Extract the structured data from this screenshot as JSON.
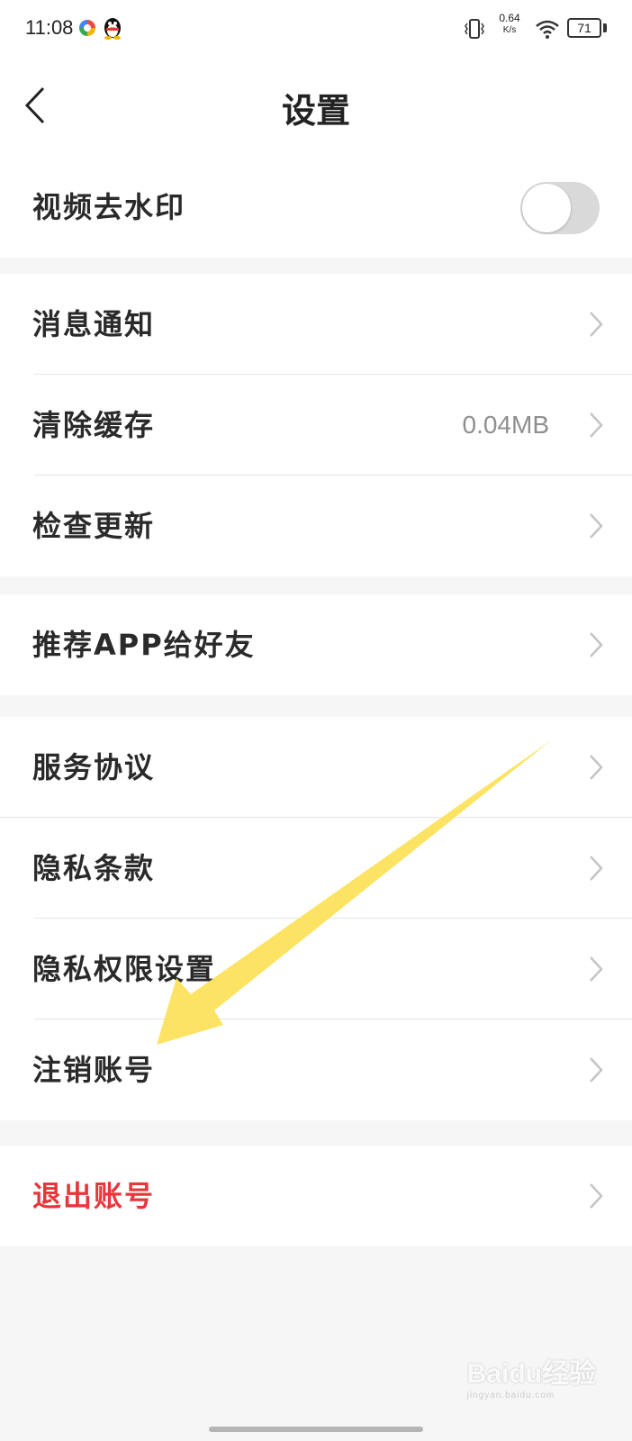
{
  "status_bar": {
    "time": "11:08",
    "net_speed_value": "0.64",
    "net_speed_unit": "K/s",
    "battery": "71",
    "icons": [
      "colorful-app-icon",
      "qq-penguin-icon",
      "vibrate-icon",
      "wifi-icon",
      "battery-icon"
    ]
  },
  "header": {
    "title": "设置",
    "back_icon": "chevron-left-icon"
  },
  "groups": [
    {
      "rows": [
        {
          "label": "视频去水印",
          "control": "toggle",
          "toggle_on": false
        }
      ]
    },
    {
      "rows": [
        {
          "label": "消息通知"
        },
        {
          "label": "清除缓存",
          "value": "0.04MB"
        },
        {
          "label": "检查更新"
        }
      ]
    },
    {
      "rows": [
        {
          "label": "推荐APP给好友"
        }
      ]
    },
    {
      "rows": [
        {
          "label": "服务协议"
        },
        {
          "label": "隐私条款"
        },
        {
          "label": "隐私权限设置"
        },
        {
          "label": "注销账号"
        }
      ]
    },
    {
      "rows": [
        {
          "label": "退出账号",
          "color": "#e8363b"
        }
      ]
    }
  ],
  "annotation": {
    "type": "arrow",
    "color": "#fde15b",
    "points_to": "注销账号"
  },
  "watermark": {
    "text": "Baidu经验",
    "sub": "jingyan.baidu.com"
  },
  "colors": {
    "background": "#f6f6f6",
    "card": "#ffffff",
    "danger": "#e8363b",
    "toggle_off": "#d9d9d9"
  }
}
